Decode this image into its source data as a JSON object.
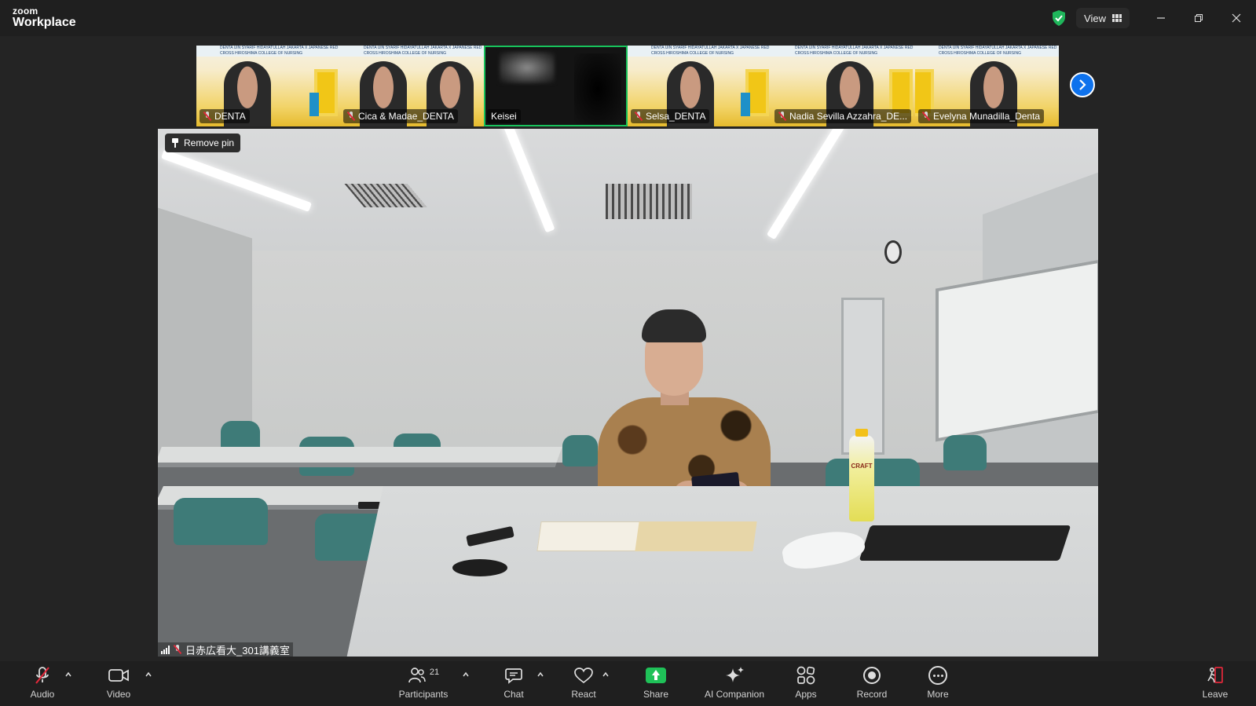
{
  "app": {
    "logo_line1": "zoom",
    "logo_line2": "Workplace",
    "view_label": "View",
    "colors": {
      "accent_blue": "#0e72ed",
      "active_green": "#18c35c",
      "share_green": "#1fc158",
      "muted_red": "#e0283a",
      "shield_green": "#1fb65b"
    }
  },
  "window_controls": {
    "minimize_icon": "minimize-icon",
    "restore_icon": "restore-icon",
    "close_icon": "close-icon"
  },
  "thumbnails": [
    {
      "name": "DENTA",
      "muted": true,
      "active": false
    },
    {
      "name": "Cica & Madae_DENTA",
      "muted": true,
      "active": false
    },
    {
      "name": "Keisei",
      "muted": false,
      "active": true
    },
    {
      "name": "Selsa_DENTA",
      "muted": true,
      "active": false
    },
    {
      "name": "Nadia Sevilla Azzahra_DE...",
      "muted": true,
      "active": false
    },
    {
      "name": "Evelyna Munadilla_Denta",
      "muted": true,
      "active": false
    }
  ],
  "thumbnail_banner_text": "DENTA UIN SYARIF HIDAYATULLAH JAKARTA X JAPANESE RED CROSS HIROSHIMA COLLEGE OF NURSING",
  "main_video": {
    "pin_label": "Remove pin",
    "participant_name": "日赤広看大_301講義室",
    "bottle_text": "CRAFT"
  },
  "toolbar": {
    "audio": "Audio",
    "video": "Video",
    "participants": "Participants",
    "participant_count": "21",
    "chat": "Chat",
    "react": "React",
    "share": "Share",
    "ai_companion": "AI Companion",
    "apps": "Apps",
    "record": "Record",
    "more": "More",
    "leave": "Leave"
  }
}
